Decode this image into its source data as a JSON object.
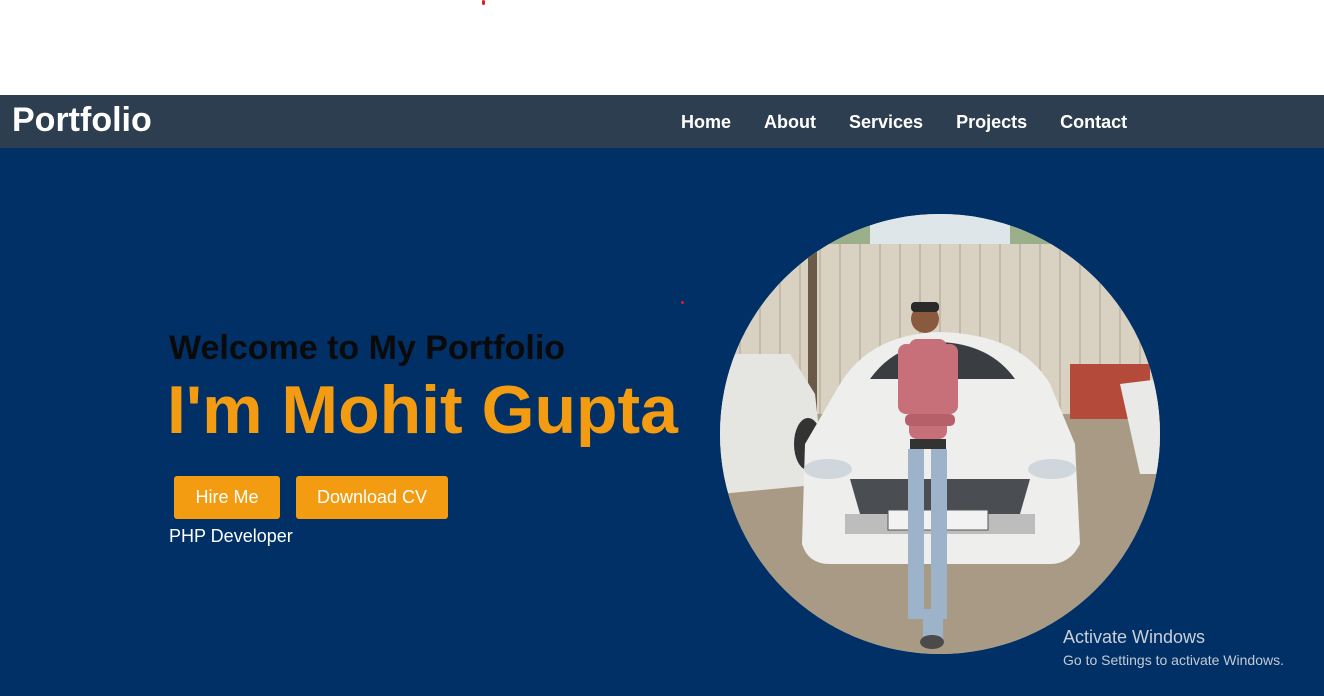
{
  "nav": {
    "brand": "Portfolio",
    "links": [
      "Home",
      "About",
      "Services",
      "Projects",
      "Contact"
    ]
  },
  "hero": {
    "welcome": "Welcome to My Portfolio",
    "name": "I'm Mohit Gupta",
    "buttons": {
      "hire": "Hire Me",
      "cv": "Download CV"
    },
    "role": "PHP Developer",
    "photo_icon": "profile-photo"
  },
  "watermark": {
    "title": "Activate Windows",
    "subtitle": "Go to Settings to activate Windows."
  },
  "colors": {
    "navbar": "#2d3e50",
    "hero_bg": "#003066",
    "accent": "#f39c12",
    "white": "#ffffff"
  }
}
